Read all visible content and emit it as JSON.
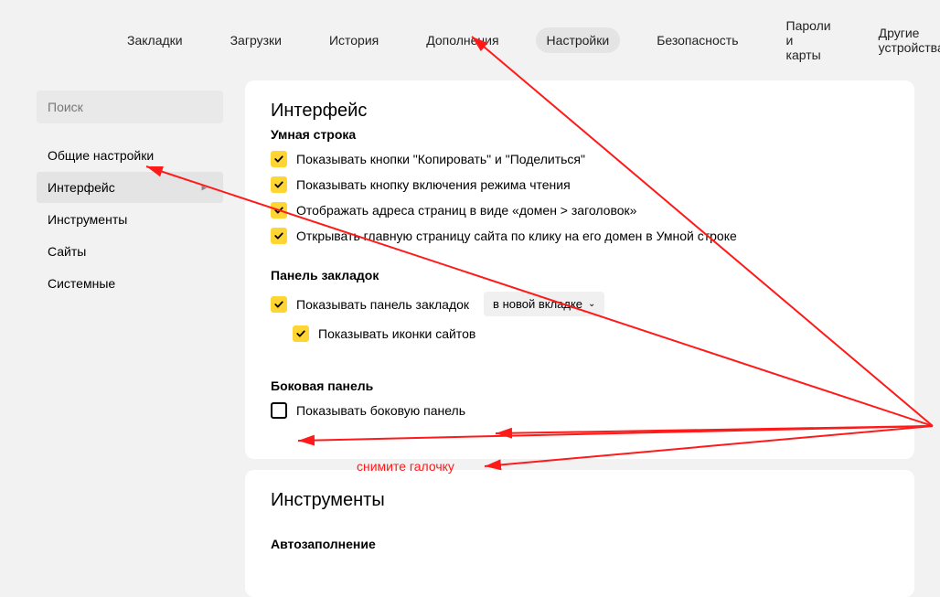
{
  "topTabs": {
    "bookmarks": "Закладки",
    "downloads": "Загрузки",
    "history": "История",
    "addons": "Дополнения",
    "settings": "Настройки",
    "security": "Безопасность",
    "passwords": "Пароли и карты",
    "devices": "Другие устройства"
  },
  "sidebar": {
    "searchPlaceholder": "Поиск",
    "items": {
      "general": "Общие настройки",
      "interface": "Интерфейс",
      "tools": "Инструменты",
      "sites": "Сайты",
      "system": "Системные"
    }
  },
  "interface": {
    "title": "Интерфейс",
    "smartLine": {
      "heading": "Умная строка",
      "opts": {
        "copyShare": "Показывать кнопки \"Копировать\" и \"Поделиться\"",
        "reader": "Показывать кнопку включения режима чтения",
        "domainTitle": "Отображать адреса страниц в виде «домен > заголовок»",
        "openMain": "Открывать главную страницу сайта по клику на его домен в Умной строке"
      }
    },
    "bookmarksBar": {
      "heading": "Панель закладок",
      "opts": {
        "show": "Показывать панель закладок",
        "icons": "Показывать иконки сайтов"
      },
      "selectValue": "в новой вкладке"
    },
    "sidePanel": {
      "heading": "Боковая панель",
      "opts": {
        "show": "Показывать боковую панель"
      }
    }
  },
  "tools": {
    "title": "Инструменты",
    "autofillHeading": "Автозаполнение"
  },
  "annotation": {
    "removeCheck": "снимите галочку"
  }
}
